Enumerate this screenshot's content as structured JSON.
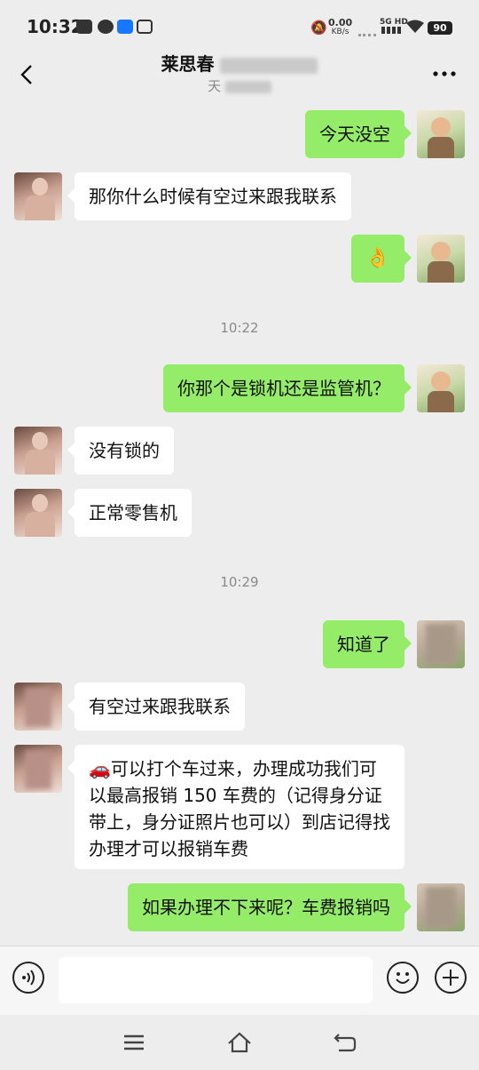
{
  "status_bar": {
    "time": "10:32",
    "net_speed": "0.00",
    "net_unit": "KB/s",
    "signal_label": "5G HD",
    "battery": "90"
  },
  "header": {
    "title": "莱思春",
    "subtitle": "天"
  },
  "messages": [
    {
      "from": "me",
      "text": "今天没空"
    },
    {
      "from": "her",
      "text": "那你什么时候有空过来跟我联系"
    },
    {
      "from": "me",
      "text": "👌"
    },
    {
      "type": "time",
      "text": "10:22"
    },
    {
      "from": "me",
      "text": "你那个是锁机还是监管机？"
    },
    {
      "from": "her",
      "text": "没有锁的"
    },
    {
      "from": "her",
      "text": "正常零售机"
    },
    {
      "type": "time",
      "text": "10:29"
    },
    {
      "from": "me",
      "text": "知道了"
    },
    {
      "from": "her",
      "text": "有空过来跟我联系"
    },
    {
      "from": "her",
      "text": "🚗可以打个车过来，办理成功我们可以最高报销 150 车费的（记得身分证带上，身分证照片也可以）到店记得找办理才可以报销车费"
    },
    {
      "from": "me",
      "text": "如果办理不下来呢？车费报销吗"
    }
  ],
  "input": {
    "placeholder": ""
  },
  "colors": {
    "my_bubble": "#95ec69",
    "her_bubble": "#ffffff",
    "background": "#ededed"
  }
}
